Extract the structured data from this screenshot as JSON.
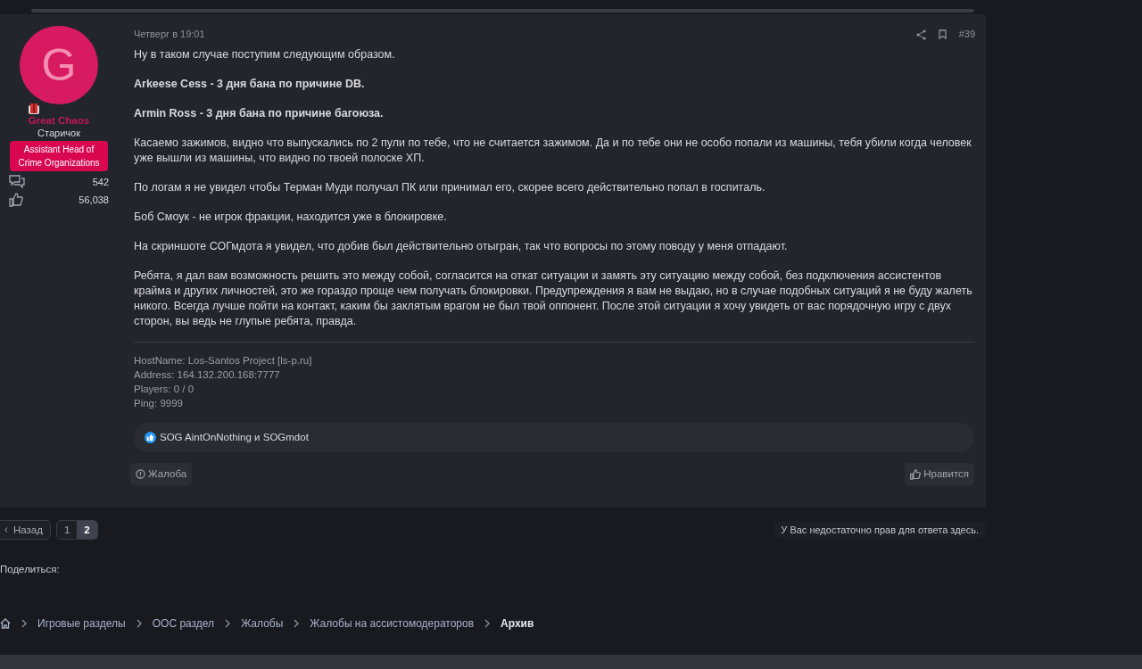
{
  "post": {
    "author": {
      "avatar_letter": "G",
      "name": "Great Chaos",
      "title": "Старичок",
      "banner": "Assistant Head of Crime Organizations",
      "stats": [
        {
          "kind": "messages",
          "value": "542"
        },
        {
          "kind": "likes",
          "value": "56,038"
        }
      ]
    },
    "date": "Четверг в 19:01",
    "number": "#39",
    "paragraphs": [
      {
        "text": "Ну в таком случае поступим следующим образом.",
        "bold": false
      },
      {
        "text": "Arkeese Cess - 3 дня бана по причине DB.",
        "bold": true
      },
      {
        "text": "Armin Ross - 3 дня бана по причине багоюза.",
        "bold": true
      },
      {
        "text": "Касаемо зажимов, видно что выпускались по 2 пули по тебе, что не считается зажимом. Да и по тебе они не особо попали из машины, тебя убили когда человек уже вышли из машины, что видно по твоей полоске ХП.",
        "bold": false
      },
      {
        "text": "По логам я не увидел чтобы Терман Муди получал ПК или принимал его, скорее всего действительно попал в госпиталь.",
        "bold": false
      },
      {
        "text": "Боб Смоук - не игрок фракции, находится уже в блокировке.",
        "bold": false
      },
      {
        "text": "На скриншоте СОГмдота я увидел, что добив был действительно отыгран, так что вопросы по этому поводу у меня отпадают.",
        "bold": false
      },
      {
        "text": "Ребята, я дал вам возможность решить это между собой, согласится на откат ситуации и замять эту ситуацию между собой, без подключения ассистентов крайма и других личностей, это же гораздо проще чем получать блокировки. Предупреждения я вам не выдаю, но в случае подобных ситуаций я не буду жалеть никого. Всегда лучше пойти на контакт, каким бы заклятым врагом не был твой оппонент. После этой ситуации я хочу увидеть от вас порядочную игру с двух сторон, вы ведь не глупые ребята, правда.",
        "bold": false
      }
    ],
    "signature": [
      "HostName: Los-Santos Project [ls-p.ru]",
      "Address: 164.132.200.168:7777",
      "Players: 0 / 0",
      "Ping: 9999"
    ],
    "reactions": "SOG AintOnNothing и SOGmdot",
    "report_button": "Жалоба",
    "like_button": "Нравится"
  },
  "pagination": {
    "prev": "Назад",
    "pages": [
      {
        "label": "1",
        "selected": false
      },
      {
        "label": "2",
        "selected": true
      }
    ]
  },
  "reply_notice": "У Вас недостаточно прав для ответа здесь.",
  "share_label": "Поделиться:",
  "breadcrumbs": [
    {
      "label": "Игровые разделы",
      "current": false
    },
    {
      "label": "ООС раздел",
      "current": false
    },
    {
      "label": "Жалобы",
      "current": false
    },
    {
      "label": "Жалобы на ассистомодераторов",
      "current": false
    },
    {
      "label": "Архив",
      "current": true
    }
  ]
}
